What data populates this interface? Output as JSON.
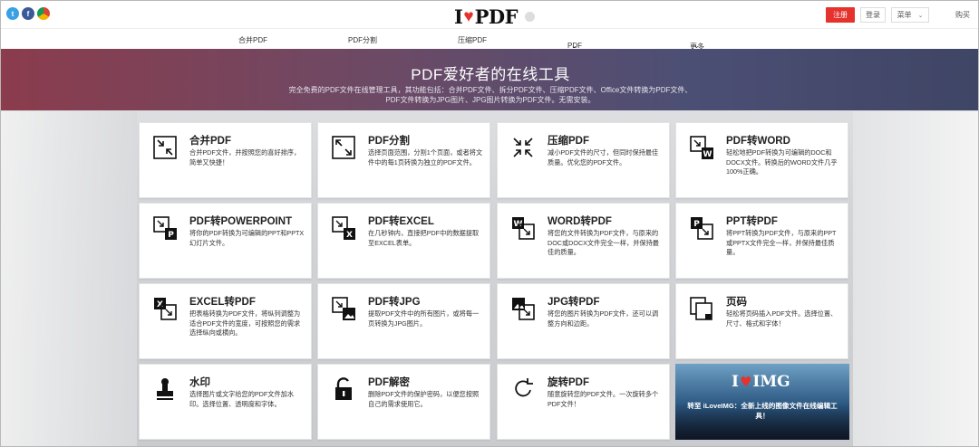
{
  "header": {
    "logo": {
      "left": "I",
      "right": "PDF"
    },
    "register": "注册",
    "login": "登录",
    "menu": "菜单",
    "buy": "购买"
  },
  "nav": [
    "合并PDF",
    "PDF分割",
    "压缩PDF",
    "PDF转换",
    "更多PDF转换工具"
  ],
  "hero": {
    "title": "PDF爱好者的在线工具",
    "lines": [
      "完全免费的PDF文件在线管理工具，其功能包括：合并PDF文件、拆分PDF文件、压缩PDF文件、Office文件转换为PDF文件、",
      "PDF文件转换为JPG图片、JPG图片转换为PDF文件。无需安装。"
    ]
  },
  "tools": [
    {
      "title": "合并PDF",
      "desc": "合并PDF文件，并按照您的喜好排序，简单又快捷！",
      "icon": "merge-icon"
    },
    {
      "title": "PDF分割",
      "desc": "选择页面范围，分割1个页面，或者将文件中的每1页转换为独立的PDF文件。",
      "icon": "split-icon"
    },
    {
      "title": "压缩PDF",
      "desc": "减小PDF文件的尺寸，但同时保持最佳质量。优化您的PDF文件。",
      "icon": "compress-icon"
    },
    {
      "title": "PDF转WORD",
      "desc": "轻松地把PDF转换为可编辑的DOC和DOCX文件。转换后的WORD文件几乎100%正确。",
      "icon": "pdf-to-word-icon"
    },
    {
      "title": "PDF转POWERPOINT",
      "desc": "将你的PDF转换为可编辑的PPT和PPTX幻灯片文件。",
      "icon": "pdf-to-ppt-icon"
    },
    {
      "title": "PDF转EXCEL",
      "desc": "在几秒钟内，直接把PDF中的数据提取至EXCEL表单。",
      "icon": "pdf-to-excel-icon"
    },
    {
      "title": "WORD转PDF",
      "desc": "将您的文件转换为PDF文件，与原来的DOC或DOCX文件完全一样，并保持最佳的质量。",
      "icon": "word-to-pdf-icon"
    },
    {
      "title": "PPT转PDF",
      "desc": "将PPT转换为PDF文件，与原来的PPT或PPTX文件完全一样，并保持最佳质量。",
      "icon": "ppt-to-pdf-icon"
    },
    {
      "title": "EXCEL转PDF",
      "desc": "把表格转换为PDF文件，将纵列调整为适合PDF文件的宽度，可按照您的需求选择纵向或横向。",
      "icon": "excel-to-pdf-icon"
    },
    {
      "title": "PDF转JPG",
      "desc": "提取PDF文件中的所有图片，或将每一页转换为JPG图片。",
      "icon": "pdf-to-jpg-icon"
    },
    {
      "title": "JPG转PDF",
      "desc": "将您的图片转换为PDF文件，还可以调整方向和边距。",
      "icon": "jpg-to-pdf-icon"
    },
    {
      "title": "页码",
      "desc": "轻松将页码插入PDF文件。选择位置、尺寸、格式和字体！",
      "icon": "page-numbers-icon"
    },
    {
      "title": "水印",
      "desc": "选择图片或文字给您的PDF文件加水印。选择位置、透明度和字体。",
      "icon": "watermark-icon"
    },
    {
      "title": "PDF解密",
      "desc": "删除PDF文件的保护密码，以便您按照自己的需求使用它。",
      "icon": "unlock-icon"
    },
    {
      "title": "旋转PDF",
      "desc": "随意旋转您的PDF文件。一次旋转多个PDF文件！",
      "icon": "rotate-icon"
    }
  ],
  "promo": {
    "logo_left": "I",
    "logo_right": "IMG",
    "text": "转至 iLoveIMG：全新上线的图像文件在线编辑工具！"
  },
  "colors": {
    "brand": "#e5322d",
    "hero_left": "#8b3c4d",
    "hero_right": "#3f4565"
  }
}
